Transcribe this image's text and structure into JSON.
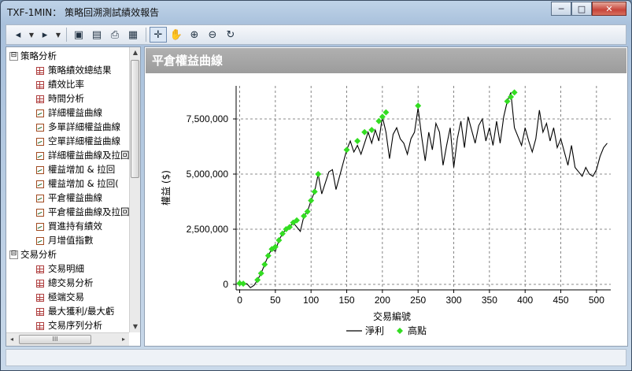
{
  "window": {
    "title": "TXF-1MIN： 策略回溯測試績效報告",
    "caption": {
      "minimize": "─",
      "maximize": "□",
      "close": "✕"
    }
  },
  "toolbar": {
    "icons": [
      "back-icon",
      "forward-icon",
      "save-icon",
      "page-setup-icon",
      "print-icon",
      "table-view-icon",
      "crosshair-icon",
      "pan-hand-icon",
      "zoom-in-icon",
      "zoom-out-icon",
      "reset-icon"
    ],
    "glyphs": {
      "back": "◂",
      "forward": "▸",
      "save": "▣",
      "page_setup": "▤",
      "print": "⎙",
      "table": "▦",
      "crosshair": "✛",
      "pan": "✋",
      "zoom_in": "⊕",
      "zoom_out": "⊖",
      "reset": "↻",
      "dropdown": "▼"
    }
  },
  "tree": {
    "groups": [
      {
        "label": "策略分析",
        "expander": "⊟",
        "items": [
          {
            "label": "策略績效總結果",
            "icon": "grid"
          },
          {
            "label": "績效比率",
            "icon": "grid"
          },
          {
            "label": "時間分析",
            "icon": "grid"
          },
          {
            "label": "詳細權益曲線",
            "icon": "chart"
          },
          {
            "label": "多單詳細權益曲線",
            "icon": "chart"
          },
          {
            "label": "空單詳細權益曲線",
            "icon": "chart"
          },
          {
            "label": "詳細權益曲線及拉回",
            "icon": "chart"
          },
          {
            "label": "權益增加 & 拉回",
            "icon": "chart"
          },
          {
            "label": "權益增加 & 拉回(",
            "icon": "chart"
          },
          {
            "label": "平倉權益曲線",
            "icon": "chart"
          },
          {
            "label": "平倉權益曲線及拉回",
            "icon": "chart"
          },
          {
            "label": "買進持有績效",
            "icon": "chart"
          },
          {
            "label": "月增值指數",
            "icon": "chart"
          }
        ]
      },
      {
        "label": "交易分析",
        "expander": "⊟",
        "items": [
          {
            "label": "交易明細",
            "icon": "grid"
          },
          {
            "label": "總交易分析",
            "icon": "grid"
          },
          {
            "label": "極端交易",
            "icon": "grid"
          },
          {
            "label": "最大獲利/最大虧",
            "icon": "grid"
          },
          {
            "label": "交易序列分析",
            "icon": "grid"
          }
        ]
      }
    ],
    "scroll": {
      "up": "▲",
      "down": "▼",
      "left": "◂",
      "right": "▸",
      "grip": "III"
    }
  },
  "chart_header": "平倉權益曲線",
  "chart_data": {
    "type": "line",
    "xlabel": "交易編號",
    "ylabel": "權益 ($)",
    "xlim": [
      -5,
      520
    ],
    "ylim": [
      -250000,
      9000000
    ],
    "x_ticks": [
      0,
      50,
      100,
      150,
      200,
      250,
      300,
      350,
      400,
      450,
      500
    ],
    "y_ticks": [
      0,
      2500000,
      5000000,
      7500000
    ],
    "y_tick_labels": [
      "0",
      "2,500,000",
      "5,000,000",
      "7,500,000"
    ],
    "grid": true,
    "legend_placement": "bottom",
    "series": [
      {
        "name": "淨利",
        "color": "#000000",
        "x": [
          0,
          5,
          10,
          15,
          20,
          25,
          30,
          35,
          40,
          45,
          50,
          55,
          60,
          65,
          70,
          75,
          80,
          85,
          90,
          95,
          100,
          105,
          110,
          115,
          120,
          125,
          130,
          135,
          140,
          145,
          150,
          155,
          160,
          165,
          170,
          175,
          180,
          185,
          190,
          195,
          200,
          205,
          210,
          215,
          220,
          225,
          230,
          235,
          240,
          245,
          250,
          255,
          260,
          265,
          270,
          275,
          280,
          285,
          290,
          295,
          300,
          305,
          310,
          315,
          320,
          325,
          330,
          335,
          340,
          345,
          350,
          355,
          360,
          365,
          370,
          375,
          380,
          385,
          390,
          395,
          400,
          405,
          410,
          415,
          420,
          425,
          430,
          435,
          440,
          445,
          450,
          455,
          460,
          465,
          470,
          475,
          480,
          485,
          490,
          495,
          500,
          505,
          510,
          515
        ],
        "y": [
          50000,
          -10000,
          30000,
          -150000,
          -50000,
          200000,
          500000,
          900000,
          1300000,
          1600000,
          1500000,
          2000000,
          2300000,
          2500000,
          2600000,
          2800000,
          2600000,
          2400000,
          3100000,
          3300000,
          3800000,
          4200000,
          5000000,
          4100000,
          4600000,
          5100000,
          5200000,
          4300000,
          4900000,
          5500000,
          6100000,
          6500000,
          6000000,
          6300000,
          5900000,
          6400000,
          6900000,
          6400000,
          7000000,
          6500000,
          7600000,
          6900000,
          5700000,
          6800000,
          7100000,
          6600000,
          6400000,
          5900000,
          6600000,
          6900000,
          8000000,
          6700000,
          5600000,
          6900000,
          6100000,
          7300000,
          6900000,
          5400000,
          6300000,
          7100000,
          5300000,
          6600000,
          7400000,
          6200000,
          7600000,
          7000000,
          6400000,
          7200000,
          7500000,
          6500000,
          7100000,
          6300000,
          7400000,
          6400000,
          7600000,
          8300000,
          8700000,
          7100000,
          6700000,
          6300000,
          7100000,
          6500000,
          6000000,
          6600000,
          7900000,
          6900000,
          7300000,
          6500000,
          7100000,
          6200000,
          6600000,
          6000000,
          5400000,
          6300000,
          5300000,
          5100000,
          4900000,
          5300000,
          5000000,
          4900000,
          5200000,
          5800000,
          6200000,
          6400000
        ]
      },
      {
        "name": "高點",
        "color": "#33dd22",
        "marker": "diamond",
        "x": [
          0,
          5,
          25,
          30,
          35,
          40,
          45,
          50,
          55,
          60,
          65,
          70,
          75,
          80,
          90,
          95,
          100,
          105,
          110,
          150,
          165,
          175,
          185,
          195,
          200,
          205,
          250,
          375,
          380,
          385
        ],
        "y": [
          50000,
          30000,
          200000,
          500000,
          900000,
          1300000,
          1600000,
          1700000,
          2000000,
          2300000,
          2500000,
          2600000,
          2800000,
          2900000,
          3100000,
          3300000,
          3800000,
          4200000,
          5000000,
          6100000,
          6500000,
          6900000,
          7000000,
          7400000,
          7600000,
          7800000,
          8100000,
          8300000,
          8500000,
          8700000
        ]
      }
    ]
  }
}
